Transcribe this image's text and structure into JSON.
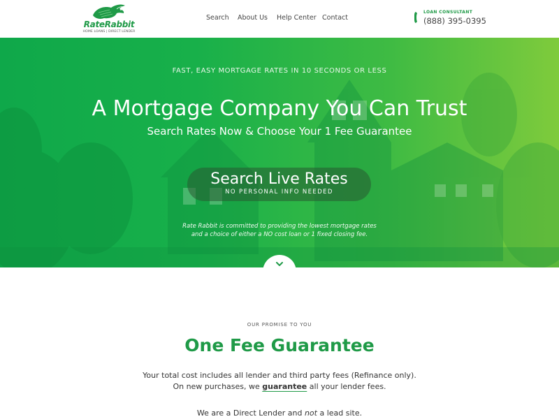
{
  "brand": {
    "name": "RateRabbit",
    "tagline": "HOME LOANS | DIRECT LENDER",
    "color": "#1f9a47"
  },
  "nav": {
    "items": [
      "Search",
      "About Us",
      "Help Center",
      "Contact"
    ]
  },
  "consultant": {
    "label": "LOAN CONSULTANT",
    "phone": "(888) 395-0395",
    "icon": "phone-icon"
  },
  "hero": {
    "tagline": "FAST, EASY MORTGAGE RATES IN 10 SECONDS OR LESS",
    "title": "A Mortgage Company You Can Trust",
    "subtitle": "Search Rates Now & Choose Your 1 Fee Guarantee",
    "cta_label": "Search Live Rates",
    "cta_sublabel": "NO PERSONAL INFO NEEDED",
    "note_line1": "Rate Rabbit is committed to providing the lowest mortgage rates",
    "note_line2": "and a choice of either a NO cost loan or 1 fixed closing fee.",
    "scroll_icon": "chevron-down-icon"
  },
  "promise": {
    "eyebrow": "OUR PROMISE TO YOU",
    "title": "One Fee Guarantee",
    "line1": "Your total cost includes all lender and third party fees (Refinance only).",
    "line2_before": "On new purchases, we ",
    "line2_emph": "guarantee",
    "line2_after": " all your lender fees.",
    "line3_before": "We are a Direct Lender and ",
    "line3_emph": "not",
    "line3_after": " a lead site."
  },
  "colors": {
    "accent": "#1f9a47",
    "hero_start": "#0fa84a",
    "hero_end": "#7fcb3c"
  }
}
